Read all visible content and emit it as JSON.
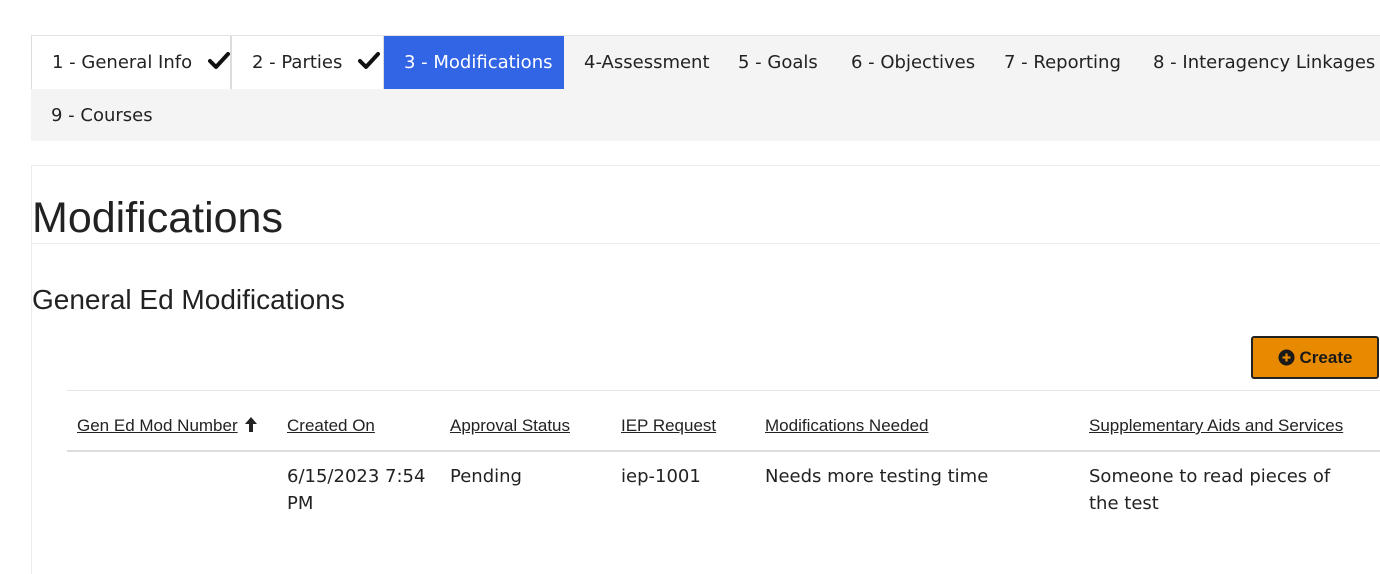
{
  "tabs": [
    {
      "label": "1 - General Info",
      "state": "done"
    },
    {
      "label": "2 - Parties",
      "state": "done"
    },
    {
      "label": "3 - Modifications",
      "state": "active"
    },
    {
      "label": "4-Assessment",
      "state": "normal"
    },
    {
      "label": "5 - Goals",
      "state": "normal"
    },
    {
      "label": "6 - Objectives",
      "state": "normal"
    },
    {
      "label": "7 - Reporting",
      "state": "normal"
    },
    {
      "label": "8 - Interagency Linkages",
      "state": "normal"
    },
    {
      "label": "9 - Courses",
      "state": "normal"
    }
  ],
  "page": {
    "title": "Modifications",
    "section_title": "General Ed Modifications"
  },
  "toolbar": {
    "create_label": "Create"
  },
  "table": {
    "columns": [
      "Gen Ed Mod Number",
      "Created On",
      "Approval Status",
      "IEP Request",
      "Modifications Needed",
      "Supplementary Aids and Services"
    ],
    "rows": [
      {
        "gen_ed_mod_number": "",
        "created_on": "6/15/2023 7:54 PM",
        "approval_status": "Pending",
        "iep_request": "iep-1001",
        "modifications_needed": "Needs more testing time",
        "supplementary_aids": "Someone to read pieces of the test"
      }
    ]
  },
  "colors": {
    "active_tab": "#3265e6",
    "create_button": "#e88a00",
    "tab_bar_bg": "#f4f4f4"
  },
  "icons": {
    "tab_done": "checkmark-icon",
    "sort": "arrow-up-icon",
    "create": "plus-circle-icon"
  }
}
